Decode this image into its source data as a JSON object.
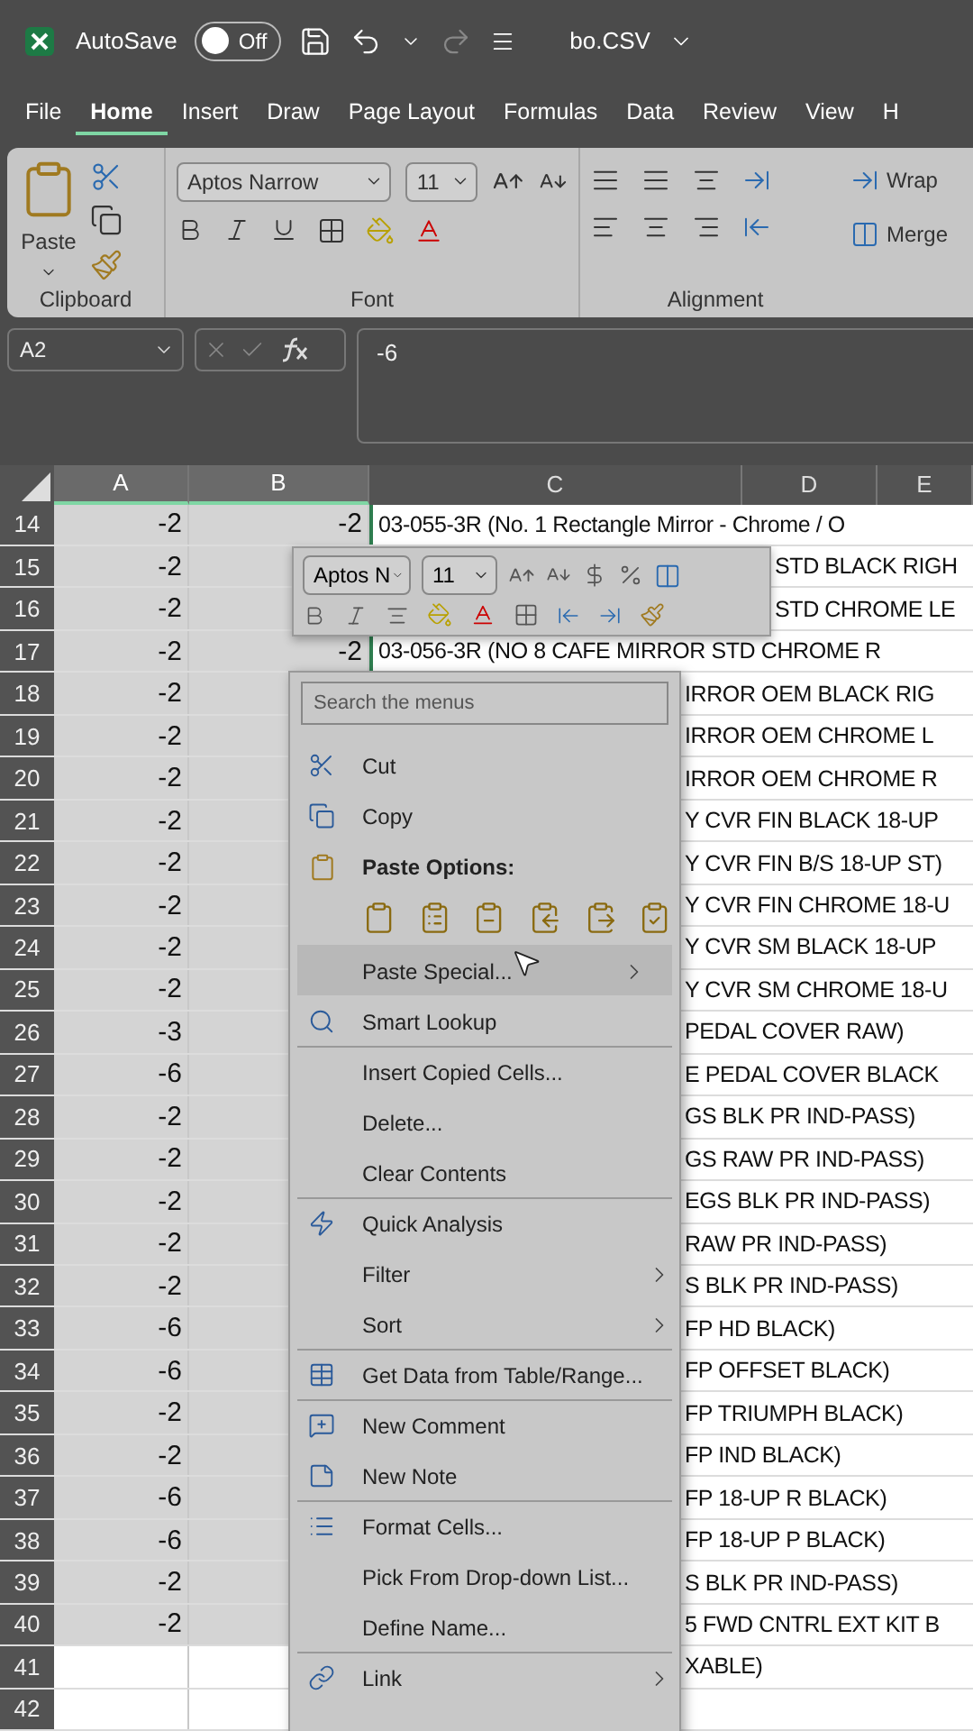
{
  "title_bar": {
    "autosave_label": "AutoSave",
    "autosave_toggle": {
      "label": "Off",
      "on": false
    },
    "file_name": "bo.CSV"
  },
  "tabs": [
    {
      "label": "File",
      "selected": false
    },
    {
      "label": "Home",
      "selected": true
    },
    {
      "label": "Insert",
      "selected": false
    },
    {
      "label": "Draw",
      "selected": false
    },
    {
      "label": "Page Layout",
      "selected": false
    },
    {
      "label": "Formulas",
      "selected": false
    },
    {
      "label": "Data",
      "selected": false
    },
    {
      "label": "Review",
      "selected": false
    },
    {
      "label": "View",
      "selected": false
    },
    {
      "label": "H",
      "selected": false
    }
  ],
  "ribbon": {
    "paste_label": "Paste",
    "font_name": "Aptos Narrow",
    "font_size": "11",
    "wrap_label": "Wrap",
    "merge_label": "Merge",
    "groups": [
      "Clipboard",
      "Font",
      "Alignment"
    ]
  },
  "formula_bar": {
    "name_box": "A2",
    "value": "-6"
  },
  "columns": [
    {
      "label": "A",
      "selected": true
    },
    {
      "label": "B",
      "selected": true
    },
    {
      "label": "C",
      "selected": false
    },
    {
      "label": "D",
      "selected": false
    },
    {
      "label": "E",
      "selected": false
    }
  ],
  "rows": [
    {
      "number": "14",
      "a": "-2",
      "b": "-2",
      "c": "03-055-3R (No. 1 Rectangle Mirror - Chrome / O"
    },
    {
      "number": "15",
      "a": "-2",
      "c": "STD BLACK RIGH"
    },
    {
      "number": "16",
      "a": "-2",
      "c": "STD CHROME LE"
    },
    {
      "number": "17",
      "a": "-2",
      "b": "-2",
      "c": "03-056-3R (NO 8 CAFE MIRROR STD CHROME R"
    },
    {
      "number": "18",
      "a": "-2",
      "c": "IRROR OEM BLACK RIG"
    },
    {
      "number": "19",
      "a": "-2",
      "c": "IRROR OEM CHROME L"
    },
    {
      "number": "20",
      "a": "-2",
      "c": "IRROR OEM CHROME R"
    },
    {
      "number": "21",
      "a": "-2",
      "c": "Y CVR FIN BLACK 18-UP"
    },
    {
      "number": "22",
      "a": "-2",
      "c": "Y CVR FIN B/S 18-UP ST)"
    },
    {
      "number": "23",
      "a": "-2",
      "c": "Y CVR FIN CHROME 18-U"
    },
    {
      "number": "24",
      "a": "-2",
      "c": "Y CVR SM BLACK 18-UP"
    },
    {
      "number": "25",
      "a": "-2",
      "c": "Y CVR SM CHROME 18-U"
    },
    {
      "number": "26",
      "a": "-3",
      "c": "PEDAL COVER RAW)"
    },
    {
      "number": "27",
      "a": "-6",
      "c": "E PEDAL COVER BLACK"
    },
    {
      "number": "28",
      "a": "-2",
      "c": "GS BLK PR IND-PASS)"
    },
    {
      "number": "29",
      "a": "-2",
      "c": "GS RAW PR IND-PASS)"
    },
    {
      "number": "30",
      "a": "-2",
      "c": "EGS BLK PR IND-PASS)"
    },
    {
      "number": "31",
      "a": "-2",
      "c": "RAW PR IND-PASS)"
    },
    {
      "number": "32",
      "a": "-2",
      "c": "S BLK PR IND-PASS)"
    },
    {
      "number": "33",
      "a": "-6",
      "c": "FP HD BLACK)"
    },
    {
      "number": "34",
      "a": "-6",
      "c": "FP OFFSET BLACK)"
    },
    {
      "number": "35",
      "a": "-2",
      "c": "FP TRIUMPH BLACK)"
    },
    {
      "number": "36",
      "a": "-2",
      "c": "FP IND BLACK)"
    },
    {
      "number": "37",
      "a": "-6",
      "c": "FP 18-UP R BLACK)"
    },
    {
      "number": "38",
      "a": "-6",
      "c": "FP 18-UP P BLACK)"
    },
    {
      "number": "39",
      "a": "-2",
      "c": "S BLK PR IND-PASS)"
    },
    {
      "number": "40",
      "a": "-2",
      "c": "5 FWD CNTRL EXT KIT B"
    },
    {
      "number": "41",
      "c": "XABLE)"
    },
    {
      "number": "42"
    }
  ],
  "mini_toolbar": {
    "font_name": "Aptos N",
    "font_size": "11"
  },
  "context_menu": {
    "search_placeholder": "Search the menus",
    "items": [
      {
        "kind": "item",
        "label": "Cut",
        "selected": false,
        "submenu": false,
        "separator_before": false
      },
      {
        "kind": "item",
        "label": "Copy",
        "selected": false,
        "submenu": false,
        "separator_before": false
      },
      {
        "kind": "header",
        "label": "Paste Options:"
      },
      {
        "kind": "paste_icons"
      },
      {
        "kind": "item",
        "label": "Paste Special...",
        "selected": true,
        "submenu": true,
        "separator_before": false
      },
      {
        "kind": "item",
        "label": "Smart Lookup",
        "selected": false,
        "submenu": false,
        "separator_before": false
      },
      {
        "kind": "item",
        "label": "Insert Copied Cells...",
        "selected": false,
        "submenu": false,
        "separator_before": true
      },
      {
        "kind": "item",
        "label": "Delete...",
        "selected": false,
        "submenu": false,
        "separator_before": false
      },
      {
        "kind": "item",
        "label": "Clear Contents",
        "selected": false,
        "submenu": false,
        "separator_before": false
      },
      {
        "kind": "item",
        "label": "Quick Analysis",
        "selected": false,
        "submenu": false,
        "separator_before": true
      },
      {
        "kind": "item",
        "label": "Filter",
        "selected": false,
        "submenu": true,
        "separator_before": false
      },
      {
        "kind": "item",
        "label": "Sort",
        "selected": false,
        "submenu": true,
        "separator_before": false
      },
      {
        "kind": "item",
        "label": "Get Data from Table/Range...",
        "selected": false,
        "submenu": false,
        "separator_before": true
      },
      {
        "kind": "item",
        "label": "New Comment",
        "selected": false,
        "submenu": false,
        "separator_before": true
      },
      {
        "kind": "item",
        "label": "New Note",
        "selected": false,
        "submenu": false,
        "separator_before": false
      },
      {
        "kind": "item",
        "label": "Format Cells...",
        "selected": false,
        "submenu": false,
        "separator_before": true
      },
      {
        "kind": "item",
        "label": "Pick From Drop-down List...",
        "selected": false,
        "submenu": false,
        "separator_before": false
      },
      {
        "kind": "item",
        "label": "Define Name...",
        "selected": false,
        "submenu": false,
        "separator_before": false
      },
      {
        "kind": "item",
        "label": "Link",
        "selected": false,
        "submenu": true,
        "separator_before": true
      }
    ]
  }
}
